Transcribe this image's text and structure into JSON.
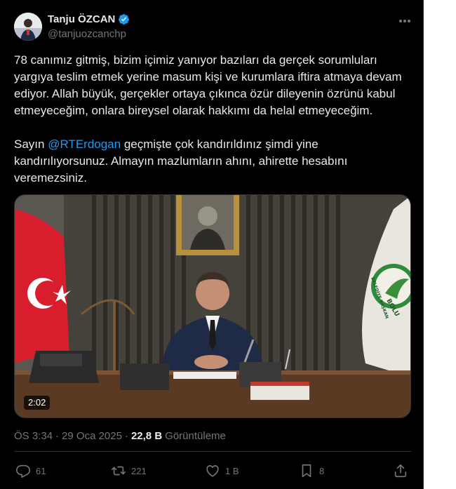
{
  "author": {
    "name": "Tanju ÖZCAN",
    "handle": "@tanjuozcanchp",
    "verified_color": "#1d9bf0"
  },
  "tweet": {
    "paragraph1": "78 canımız gitmiş, bizim içimiz yanıyor bazıları da gerçek sorumluları yargıya teslim etmek yerine masum kişi ve kurumlara iftira atmaya devam ediyor. Allah büyük, gerçekler ortaya çıkınca özür dileyenin özrünü kabul etmeyeceğim, onlara bireysel olarak hakkımı da helal etmeyeceğim.",
    "p2_prefix": "Sayın ",
    "mention": "@RTErdogan",
    "p2_suffix": " geçmişte çok kandırıldınız şimdi yine kandırılıyorsunuz. Almayın mazlumların ahını, ahirette hesabını veremezsiniz.",
    "accent_color": "#1d9bf0"
  },
  "media": {
    "type": "video",
    "duration": "2:02",
    "logo_text": "BOLU",
    "logo_arc_text": "BELEDİYE BAŞKAN"
  },
  "meta": {
    "time": "ÖS 3:34",
    "separator": "·",
    "date": "29 Oca 2025",
    "separator2": "·",
    "views_count": "22,8 B",
    "views_label": "Görüntüleme"
  },
  "actions": {
    "replies": "61",
    "reposts": "221",
    "likes": "1 B",
    "bookmarks": "8",
    "icons": [
      "reply-icon",
      "repost-icon",
      "like-icon",
      "bookmark-icon",
      "share-icon"
    ]
  }
}
